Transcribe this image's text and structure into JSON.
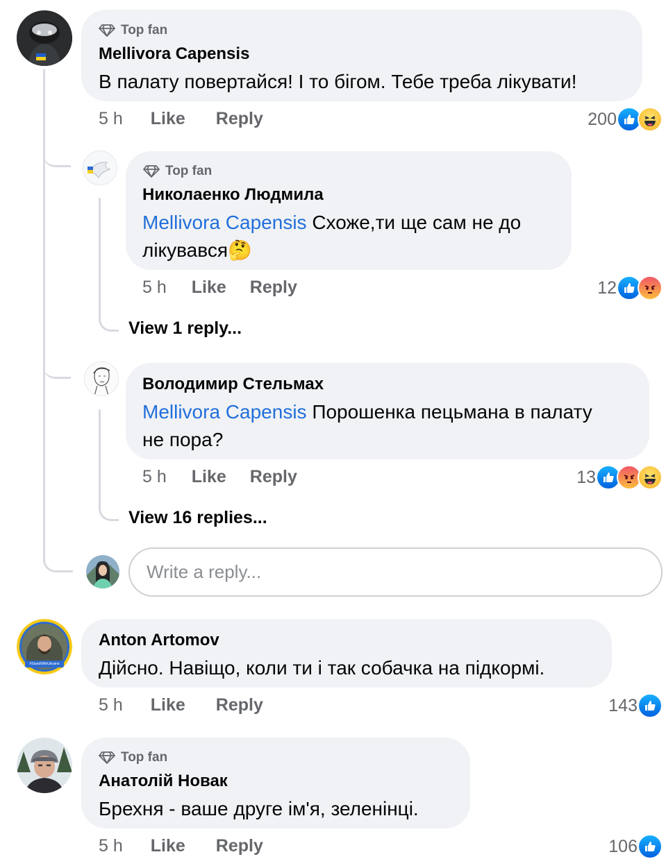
{
  "comments": [
    {
      "top_fan": "Top fan",
      "author": "Mellivora Capensis",
      "text": "В палату повертайся! І то бігом. Тебе треба лікувати!",
      "time": "5 h",
      "like": "Like",
      "reply": "Reply",
      "reaction_count": "200",
      "reactions": [
        "like-icon",
        "haha-icon"
      ],
      "replies": [
        {
          "top_fan": "Top fan",
          "author": "Николаенко Людмила",
          "mention": "Mellivora Capensis",
          "text": " Схоже,ти ще сам не до",
          "text_line2": "лікувався",
          "emoji": "🤔",
          "time": "5 h",
          "like": "Like",
          "reply": "Reply",
          "reaction_count": "12",
          "reactions": [
            "like-icon",
            "angry-icon"
          ],
          "view_replies": "View 1 reply..."
        },
        {
          "author": "Володимир Стельмах",
          "mention": "Mellivora Capensis",
          "text": " Порошенка пецьмана в палату",
          "text_line2": "не пора?",
          "time": "5 h",
          "like": "Like",
          "reply": "Reply",
          "reaction_count": "13",
          "reactions": [
            "like-icon",
            "angry-icon",
            "haha-icon"
          ],
          "view_replies": "View 16 replies..."
        }
      ],
      "reply_placeholder": "Write a reply..."
    },
    {
      "author": "Anton Artomov",
      "text": "Дійсно. Навіщо, коли ти і так собачка на підкормі.",
      "time": "5 h",
      "like": "Like",
      "reply": "Reply",
      "reaction_count": "143",
      "reactions": [
        "like-icon"
      ],
      "avatar_badge": "#StandWithUkraine"
    },
    {
      "top_fan": "Top fan",
      "author": "Анатолій Новак",
      "text": "Брехня - ваше друге ім'я, зеленінці.",
      "time": "5 h",
      "like": "Like",
      "reply": "Reply",
      "reaction_count": "106",
      "reactions": [
        "like-icon"
      ]
    }
  ],
  "colors": {
    "bubble": "#f0f2f5",
    "mention": "#216fdb",
    "meta": "#65676b",
    "like": "#1877f2"
  }
}
